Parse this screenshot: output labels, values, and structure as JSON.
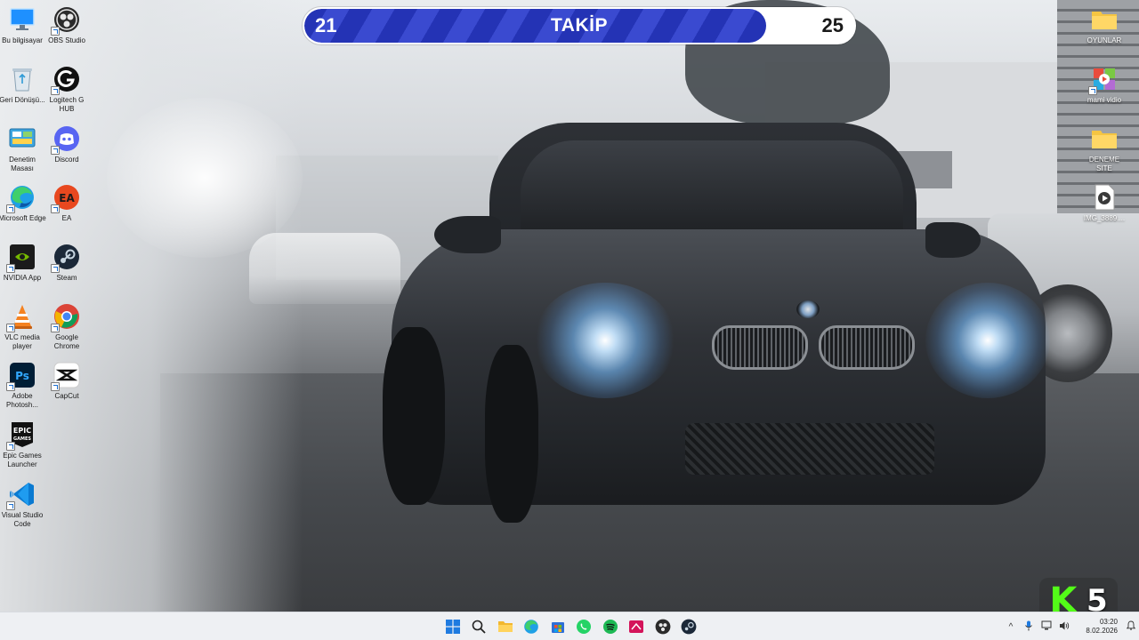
{
  "desktop_icons_left": [
    {
      "name": "this-pc",
      "label": "Bu bilgisayar",
      "icon": "monitor-icon"
    },
    {
      "name": "obs-studio",
      "label": "OBS Studio",
      "icon": "obs-icon"
    },
    {
      "name": "recycle-bin",
      "label": "Geri Dönüşü...",
      "icon": "recycle-bin-icon"
    },
    {
      "name": "logitech-g-hub",
      "label": "Logitech G HUB",
      "icon": "logitech-icon"
    },
    {
      "name": "control-panel",
      "label": "Denetim Masası",
      "icon": "control-panel-icon"
    },
    {
      "name": "discord",
      "label": "Discord",
      "icon": "discord-icon"
    },
    {
      "name": "microsoft-edge",
      "label": "Microsoft Edge",
      "icon": "edge-icon"
    },
    {
      "name": "ea",
      "label": "EA",
      "icon": "ea-icon"
    },
    {
      "name": "nvidia-app",
      "label": "NVIDIA App",
      "icon": "nvidia-icon"
    },
    {
      "name": "steam",
      "label": "Steam",
      "icon": "steam-icon"
    },
    {
      "name": "vlc",
      "label": "VLC media player",
      "icon": "vlc-icon"
    },
    {
      "name": "google-chrome",
      "label": "Google Chrome",
      "icon": "chrome-icon"
    },
    {
      "name": "adobe-photoshop",
      "label": "Adobe Photosh...",
      "icon": "photoshop-icon"
    },
    {
      "name": "capcut",
      "label": "CapCut",
      "icon": "capcut-icon"
    },
    {
      "name": "epic-games",
      "label": "Epic Games Launcher",
      "icon": "epic-icon"
    },
    {
      "name": "vscode",
      "label": "Visual Studio Code",
      "icon": "vscode-icon"
    }
  ],
  "desktop_icons_right": [
    {
      "name": "oyunlar-folder",
      "label": "OYUNLAR",
      "icon": "folder-icon"
    },
    {
      "name": "mami-vidio",
      "label": "mami vidio",
      "icon": "video-editor-icon"
    },
    {
      "name": "deneme-site-folder",
      "label": "DENEME SITE",
      "icon": "folder-icon"
    },
    {
      "name": "img-file",
      "label": "IMG_3889....",
      "icon": "video-file-icon"
    }
  ],
  "follow_goal": {
    "current": "21",
    "label": "TAKİP",
    "target": "25",
    "progress": 0.84,
    "fill_color": "#2433b5"
  },
  "kick_badge": {
    "letter": "K",
    "number": "5",
    "accent": "#53fc18"
  },
  "taskbar": {
    "apps": [
      {
        "name": "start-button",
        "icon": "windows-icon"
      },
      {
        "name": "search-button",
        "icon": "search-icon"
      },
      {
        "name": "file-explorer-button",
        "icon": "folder-icon"
      },
      {
        "name": "edge-taskbar-button",
        "icon": "edge-icon"
      },
      {
        "name": "store-button",
        "icon": "store-icon"
      },
      {
        "name": "whatsapp-button",
        "icon": "whatsapp-icon"
      },
      {
        "name": "spotify-button",
        "icon": "spotify-icon"
      },
      {
        "name": "app-red-button",
        "icon": "red-app-icon"
      },
      {
        "name": "obs-taskbar-button",
        "icon": "obs-icon"
      },
      {
        "name": "steam-taskbar-button",
        "icon": "steam-icon"
      }
    ],
    "tray": {
      "chevron": "^",
      "time": "03:20",
      "date": "8.02.2026"
    }
  }
}
